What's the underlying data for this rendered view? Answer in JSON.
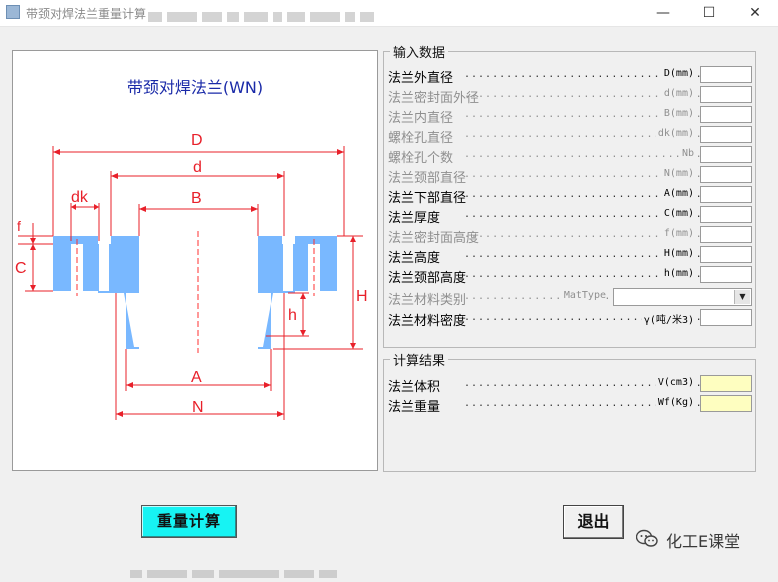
{
  "window": {
    "title": "带颈对焊法兰重量计算",
    "minimize_glyph": "—",
    "maximize_glyph": "☐",
    "close_glyph": "✕"
  },
  "drawing": {
    "title": "带颈对焊法兰(WN)",
    "labels": {
      "D": "D",
      "d": "d",
      "dk": "dk",
      "B": "B",
      "f": "f",
      "C": "C",
      "h": "h",
      "H": "H",
      "A": "A",
      "N": "N"
    },
    "colors": {
      "dimension": "#e8202a",
      "flange": "#79b8ff",
      "centerline": "#ff3030"
    }
  },
  "input": {
    "legend": "输入数据",
    "rows": [
      {
        "label": "法兰外直径",
        "symbol": "D(mm)",
        "value": "",
        "enabled": true
      },
      {
        "label": "法兰密封面外径",
        "symbol": "d(mm)",
        "value": "",
        "enabled": false
      },
      {
        "label": "法兰内直径",
        "symbol": "B(mm)",
        "value": "",
        "enabled": false
      },
      {
        "label": "螺栓孔直径",
        "symbol": "dk(mm)",
        "value": "",
        "enabled": false
      },
      {
        "label": "螺栓孔个数",
        "symbol": "Nb",
        "value": "",
        "enabled": false
      },
      {
        "label": "法兰颈部直径",
        "symbol": "N(mm)",
        "value": "",
        "enabled": false
      },
      {
        "label": "法兰下部直径",
        "symbol": "A(mm)",
        "value": "",
        "enabled": true
      },
      {
        "label": "法兰厚度",
        "symbol": "C(mm)",
        "value": "",
        "enabled": true
      },
      {
        "label": "法兰密封面高度",
        "symbol": "f(mm)",
        "value": "",
        "enabled": false
      },
      {
        "label": "法兰高度",
        "symbol": "H(mm)",
        "value": "",
        "enabled": true
      },
      {
        "label": "法兰颈部高度",
        "symbol": "h(mm)",
        "value": "",
        "enabled": true
      }
    ],
    "material_type": {
      "label": "法兰材料类别",
      "symbol": "MatType",
      "value": "",
      "enabled": false
    },
    "density": {
      "label": "法兰材料密度",
      "symbol": "γ(吨/米3)",
      "value": "",
      "enabled": true
    }
  },
  "results": {
    "legend": "计算结果",
    "rows": [
      {
        "label": "法兰体积",
        "symbol": "V(cm3)",
        "value": ""
      },
      {
        "label": "法兰重量",
        "symbol": "Wf(Kg)",
        "value": ""
      }
    ]
  },
  "buttons": {
    "calculate": "重量计算",
    "exit": "退出"
  },
  "watermark": {
    "text": "化工E课堂"
  }
}
